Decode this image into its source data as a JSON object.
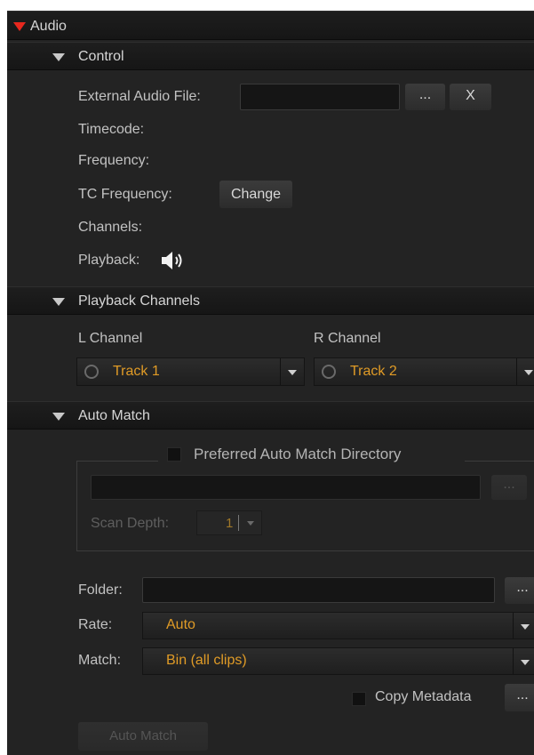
{
  "audio": {
    "title": "Audio"
  },
  "control": {
    "title": "Control",
    "external_audio_label": "External Audio File:",
    "external_audio_value": "",
    "browse_label": "...",
    "clear_label": "X",
    "timecode_label": "Timecode:",
    "frequency_label": "Frequency:",
    "tc_frequency_label": "TC Frequency:",
    "change_label": "Change",
    "channels_label": "Channels:",
    "playback_label": "Playback:",
    "playback_icon": "speaker-icon"
  },
  "playback_channels": {
    "title": "Playback Channels",
    "l_label": "L Channel",
    "r_label": "R Channel",
    "l_value": "Track 1",
    "r_value": "Track 2"
  },
  "auto_match": {
    "title": "Auto Match",
    "preferred_dir_label": "Preferred Auto Match Directory",
    "preferred_dir_checked": false,
    "preferred_dir_value": "",
    "preferred_browse_label": "...",
    "scan_depth_label": "Scan Depth:",
    "scan_depth_value": "1",
    "folder_label": "Folder:",
    "folder_value": "",
    "folder_browse_label": "...",
    "rate_label": "Rate:",
    "rate_value": "Auto",
    "match_label": "Match:",
    "match_value": "Bin (all clips)",
    "copy_metadata_label": "Copy Metadata",
    "copy_metadata_checked": false,
    "copy_metadata_more_label": "...",
    "auto_match_button": "Auto Match"
  },
  "colors": {
    "panel_bg": "#232323",
    "accent_orange": "#e09b26",
    "expand_red": "#e8281e",
    "text": "#c2c2c2"
  }
}
